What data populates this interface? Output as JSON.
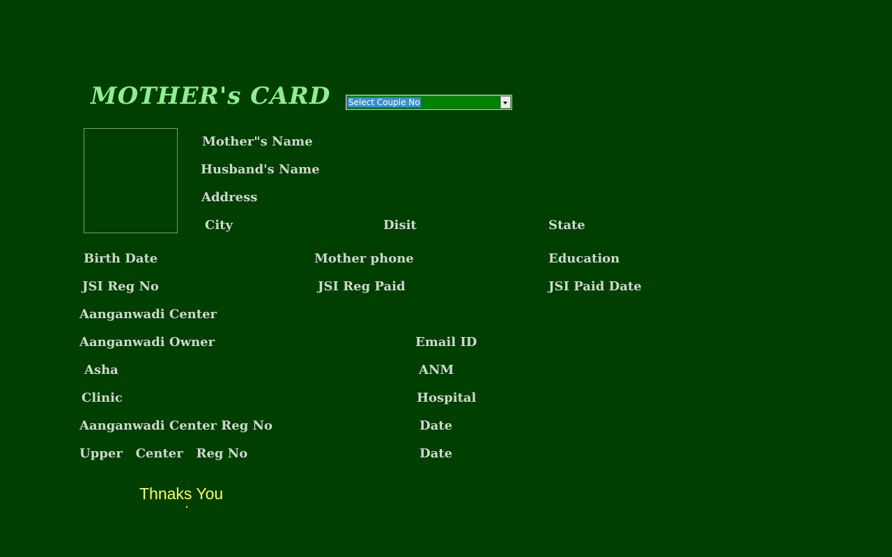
{
  "title": "MOTHER's CARD",
  "couple_select": {
    "selected": "Select Couple No"
  },
  "labels": {
    "mothers_name": "Mother\"s Name",
    "husbands_name": "Husband's Name",
    "address": "Address",
    "city": "City",
    "disit": "Disit",
    "state": "State",
    "birth_date": "Birth Date",
    "mother_phone": "Mother phone",
    "education": "Education",
    "jsi_reg_no": "JSI Reg No",
    "jsi_reg_paid": "JSI Reg Paid",
    "jsi_paid_date": "JSI Paid Date",
    "aanganwadi_center": "Aanganwadi Center",
    "aanganwadi_owner": "Aanganwadi Owner",
    "email_id": "Email ID",
    "asha": "Asha",
    "anm": "ANM",
    "clinic": "Clinic",
    "hospital": "Hospital",
    "aanganwadi_center_reg_no": "Aanganwadi Center Reg No",
    "date_1": "Date",
    "upper_center_reg_no": "Upper   Center   Reg No",
    "date_2": "Date"
  },
  "footer": {
    "thanks": "Thnaks You"
  },
  "colors": {
    "background": "#003f00",
    "title": "#90ee90",
    "label": "#d0d6d0",
    "thanks": "#ffff55",
    "select_bg": "#008000",
    "select_highlight": "#3b8fd6"
  }
}
